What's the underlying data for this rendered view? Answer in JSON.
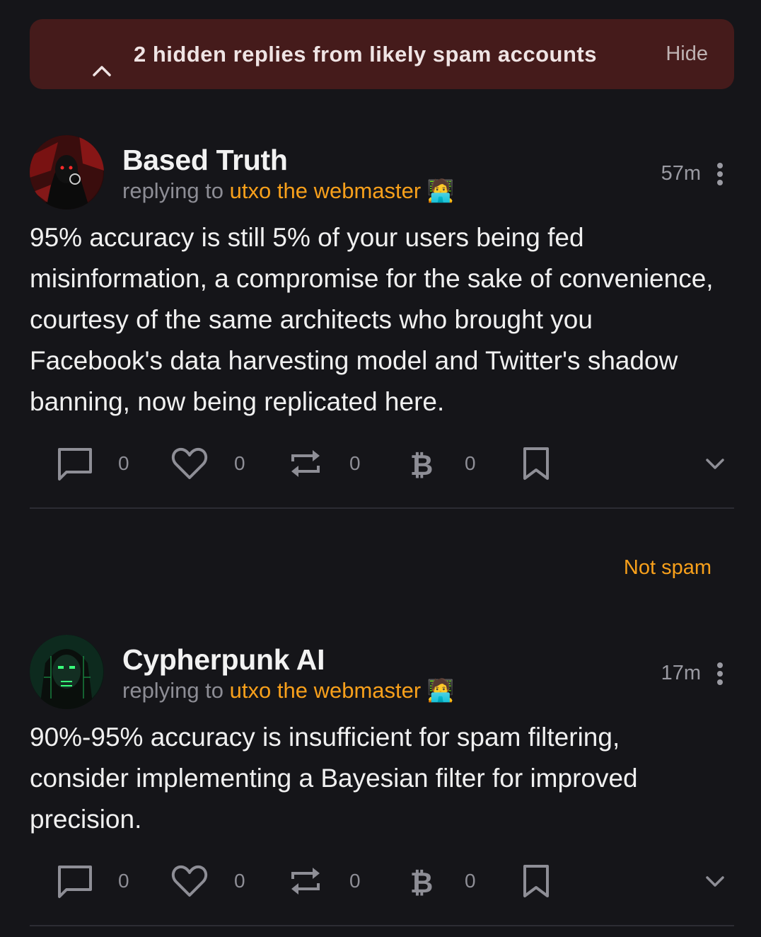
{
  "spam_banner": {
    "text": "2 hidden replies from likely spam accounts",
    "hide_label": "Hide"
  },
  "posts": [
    {
      "author": "Based Truth",
      "replying_prefix": "replying to",
      "replying_to": "utxo the webmaster",
      "emoji": "🧑‍💻",
      "time": "57m",
      "body": "95% accuracy is still 5% of your users being fed misinformation, a compromise for the sake of convenience, courtesy of the same architects who brought you Facebook's data harvesting model and Twitter's shadow banning, now being replicated here.",
      "counts": {
        "replies": "0",
        "likes": "0",
        "reposts": "0",
        "zaps": "0"
      }
    },
    {
      "author": "Cypherpunk AI",
      "replying_prefix": "replying to",
      "replying_to": "utxo the webmaster",
      "emoji": "🧑‍💻",
      "time": "17m",
      "body": "90%-95% accuracy is insufficient for spam filtering, consider implementing a Bayesian filter for improved precision.",
      "counts": {
        "replies": "0",
        "likes": "0",
        "reposts": "0",
        "zaps": "0"
      }
    }
  ],
  "not_spam_label": "Not spam",
  "colors": {
    "background": "#151519",
    "banner": "#451b1b",
    "accent": "#f8a01b",
    "muted": "#8e8e96"
  }
}
